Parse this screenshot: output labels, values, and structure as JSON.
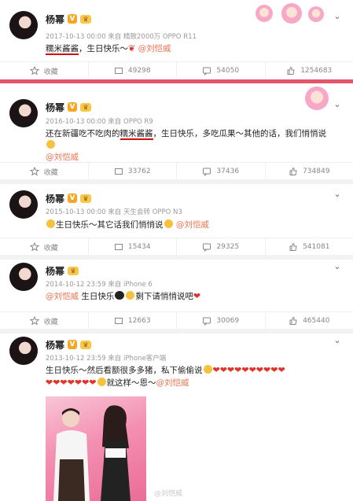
{
  "posts": [
    {
      "name": "杨幂",
      "meta": "2017-10-13 00:00 来自 精致2000万 OPPO R11",
      "content_prefix": "糯米酱酱",
      "content_rest": "，生日快乐～",
      "mention": "@刘恺威",
      "actions": {
        "repost": "收藏",
        "share": "49298",
        "comment": "54050",
        "like": "1254683"
      }
    },
    {
      "name": "杨幂",
      "meta": "2016-10-13 00:00 来自 OPPO R9",
      "content_a": "还在新疆吃不吃肉的",
      "content_b": "糯米酱酱",
      "content_c": "，生日快乐，多吃瓜果～其他的话，我们悄悄说",
      "mention": "@刘恺威",
      "actions": {
        "repost": "收藏",
        "share": "33762",
        "comment": "37436",
        "like": "734849"
      }
    },
    {
      "name": "杨幂",
      "meta": "2015-10-13 00:00 来自 天生会转 OPPO N3",
      "content": "生日快乐～其它话我们悄悄说",
      "mention": "@刘恺威",
      "actions": {
        "repost": "收藏",
        "share": "15434",
        "comment": "29325",
        "like": "541081"
      }
    },
    {
      "name": "杨幂",
      "meta": "2014-10-12 23:59 来自 iPhone 6",
      "mention": "@刘恺威",
      "content_a": "生日快乐",
      "content_b": "剩下请悄悄说吧",
      "actions": {
        "repost": "收藏",
        "share": "12663",
        "comment": "30069",
        "like": "465440"
      }
    },
    {
      "name": "杨幂",
      "meta": "2013-10-12 23:59 来自 iPhone客户端",
      "content_line1a": "生日快乐～然后看额很多多猪，私下偷偷说",
      "content_line2b": "就这样～恩～",
      "mention": "@刘恺威"
    }
  ],
  "watermark": "@刘恺威"
}
